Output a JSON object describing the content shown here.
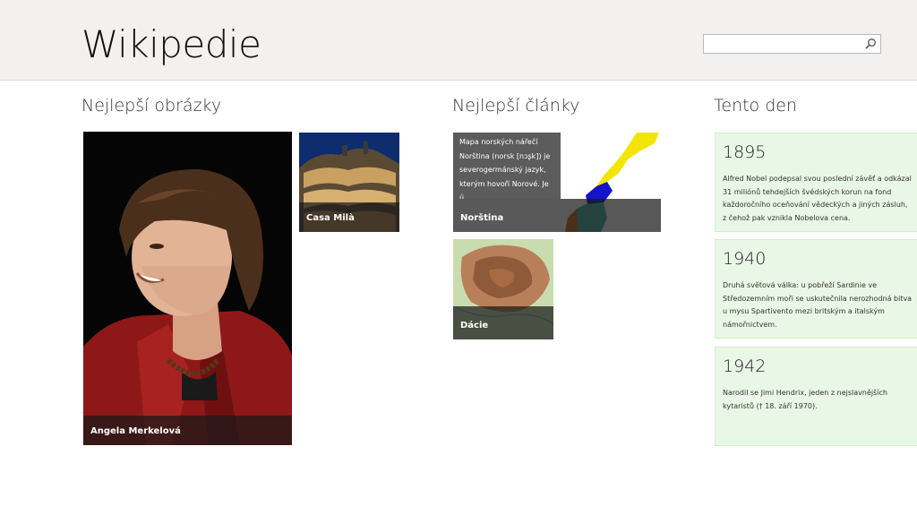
{
  "app": {
    "title": "Wikipedie"
  },
  "search": {
    "placeholder": "",
    "value": "",
    "icon": "search-icon"
  },
  "sections": {
    "pictures": {
      "title": "Nejlepší obrázky",
      "tiles": [
        {
          "caption": "Angela Merkelová"
        },
        {
          "caption": "Casa Milà"
        }
      ]
    },
    "articles": {
      "title": "Nejlepší články",
      "tiles": [
        {
          "caption": "Norština",
          "snippet": "Mapa norských nářečí Norština (norsk [nɔʂk]) je severogermánský jazyk, kterým hovoří Norové. Je ú..."
        },
        {
          "caption": "Dácie"
        }
      ]
    },
    "today": {
      "title": "Tento den",
      "events": [
        {
          "year": "1895",
          "text": "Alfred Nobel podepsal svou poslední závěť a odkázal 31 miliónů tehdejších švédských korun na fond každoročního oceňování vědeckých a jiných zásluh, z čehož pak vznikla Nobelova cena."
        },
        {
          "year": "1940",
          "text": "Druhá světová válka: u pobřeží Sardinie ve Středozemním moři se uskutečnila nerozhodná bitva u mysu Spartivento mezi britským a italským námořnictvem."
        },
        {
          "year": "1942",
          "text": "Narodil se Jimi Hendrix, jeden z nejslavnějších kytaristů († 18. září 1970)."
        }
      ]
    }
  },
  "colors": {
    "header_bg": "#f2f1ef",
    "card_bg": "#e9f8e6",
    "caption_bg": "#191919"
  }
}
